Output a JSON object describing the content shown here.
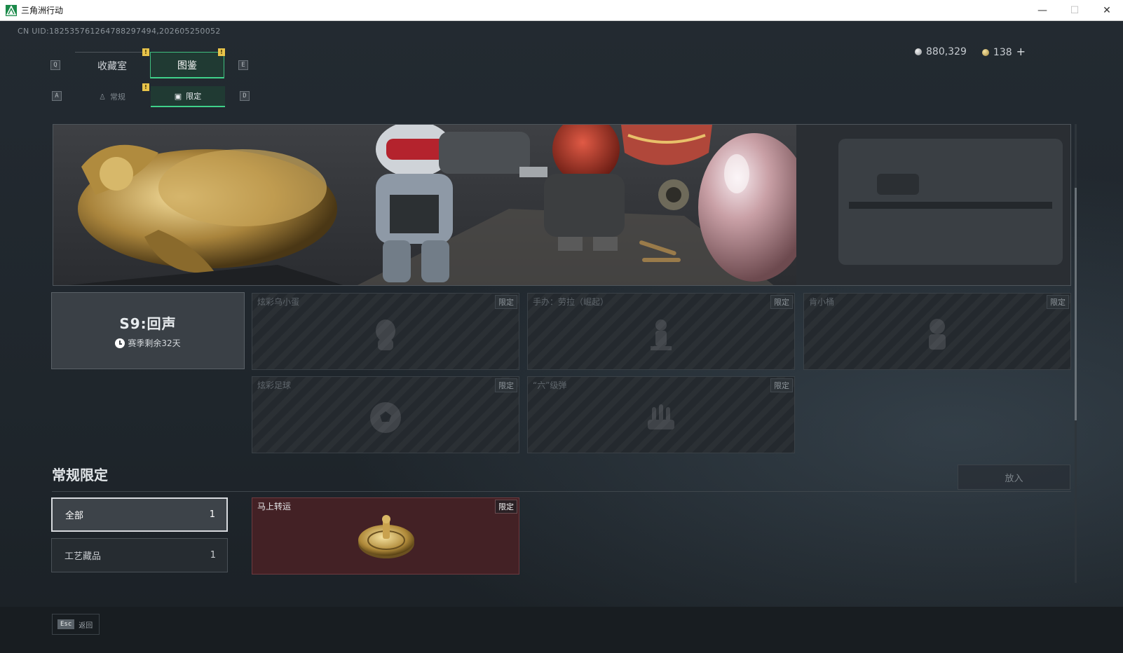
{
  "window": {
    "title": "三角洲行动",
    "controls": {
      "minimize": "—",
      "maximize": "☐",
      "close": "✕"
    }
  },
  "uid_text": "CN UID:1825357612647882974             4,202605250052",
  "uid_display": "CN UID:182535761264788297494,202605250052",
  "currency": {
    "silver": "880,329",
    "gold": "138",
    "plus": "+"
  },
  "tabs": {
    "main": [
      {
        "label": "收藏室",
        "active": false
      },
      {
        "label": "图鉴",
        "active": true
      }
    ],
    "sub": [
      {
        "label": "常规",
        "active": false
      },
      {
        "label": "限定",
        "active": true
      }
    ],
    "keys": {
      "left_main": "Q",
      "right_main": "E",
      "left_sub": "A",
      "right_sub": "D"
    },
    "notice_mark": "!"
  },
  "season": {
    "title": "S9:回声",
    "remaining": "赛季剩余32天"
  },
  "limited_items": [
    {
      "name": "炫彩乌小蛋",
      "tag": "限定",
      "icon": "egg-figure-icon"
    },
    {
      "name": "手办：劳拉（崛起）",
      "tag": "限定",
      "icon": "figure-icon"
    },
    {
      "name": "肯小桶",
      "tag": "限定",
      "icon": "bucket-figure-icon"
    },
    {
      "name": "炫彩足球",
      "tag": "限定",
      "icon": "football-icon"
    },
    {
      "name": "“六”级弹",
      "tag": "限定",
      "icon": "bullet-icon"
    }
  ],
  "section": {
    "title": "常规限定",
    "put_button": "放入",
    "filters": [
      {
        "label": "全部",
        "count": "1",
        "active": true
      },
      {
        "label": "工艺藏品",
        "count": "1",
        "active": false
      }
    ],
    "owned_items": [
      {
        "name": "马上转运",
        "tag": "限定",
        "icon": "golden-disc-icon"
      }
    ]
  },
  "bottom": {
    "esc_key": "Esc",
    "back_label": "返回"
  },
  "colors": {
    "accent_green": "#3fd28a",
    "owned_card": "#432125",
    "notice_yellow": "#e8c44a"
  }
}
